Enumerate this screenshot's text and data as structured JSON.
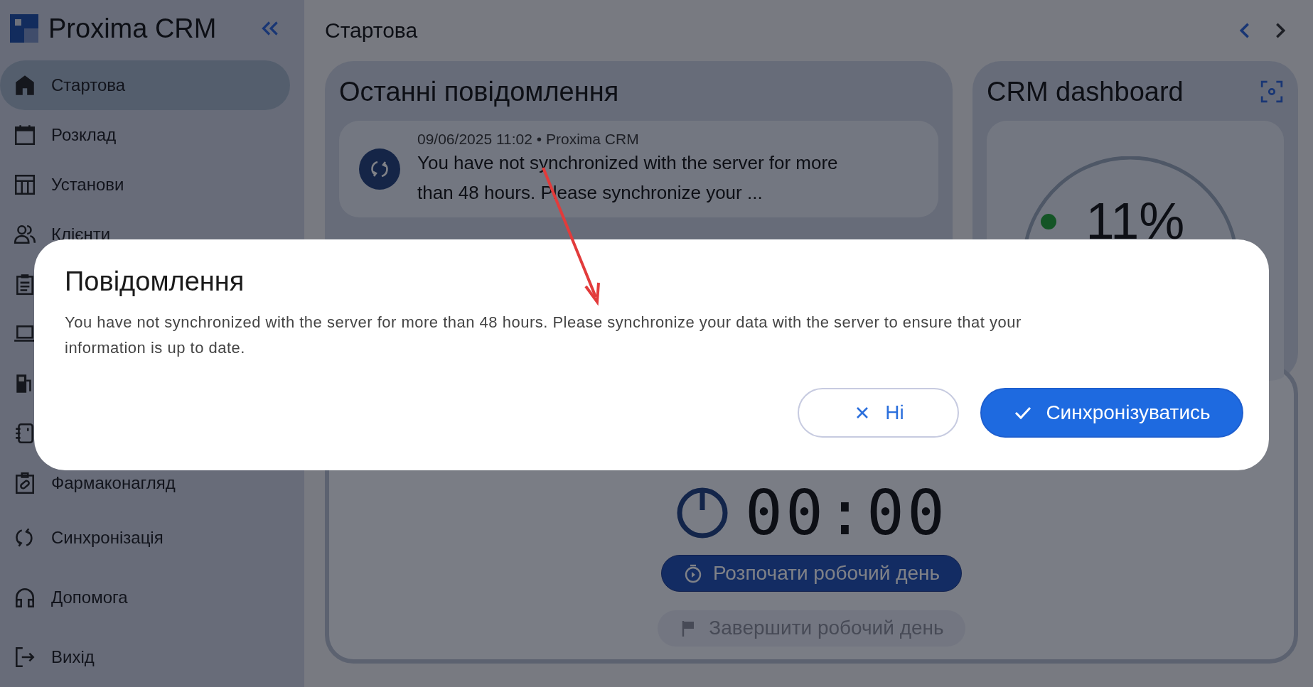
{
  "app": {
    "name": "Proxima CRM"
  },
  "sidebar": {
    "items": [
      {
        "label": "Стартова",
        "selected": true
      },
      {
        "label": "Розклад",
        "selected": false
      },
      {
        "label": "Установи",
        "selected": false
      },
      {
        "label": "Клієнти",
        "selected": false
      },
      {
        "selected": false
      },
      {
        "selected": false
      },
      {
        "selected": false
      },
      {
        "selected": false
      },
      {
        "label": "Фармаконагляд",
        "selected": false
      }
    ],
    "bottom_items": [
      {
        "label": "Синхронізація",
        "selected": false
      },
      {
        "label": "Допомога",
        "selected": false
      },
      {
        "label": "Вихід",
        "selected": false
      }
    ]
  },
  "header": {
    "title": "Стартова"
  },
  "messages_card": {
    "title": "Останні повідомлення",
    "messages": [
      {
        "meta": "09/06/2025 11:02 • Proxima CRM",
        "text": "You have not synchronized with the server for more than 48 hours. Please synchronize your ..."
      }
    ]
  },
  "dashboard_card": {
    "title": "CRM dashboard",
    "percent": "11%"
  },
  "workday_card": {
    "timer": "00:00",
    "start_button": {
      "label": "Розпочати робочий день"
    },
    "finish_button": {
      "label": "Завершити робочий день",
      "disabled": true
    }
  },
  "dialog": {
    "title": "Повідомлення",
    "text": "You have not synchronized with the server for more than 48 hours. Please synchronize your data with the server to ensure that your information is up to date.",
    "buttons": [
      {
        "kind": "cancel",
        "label": "Ні"
      },
      {
        "kind": "confirm",
        "label": "Синхронізуватись"
      }
    ]
  }
}
